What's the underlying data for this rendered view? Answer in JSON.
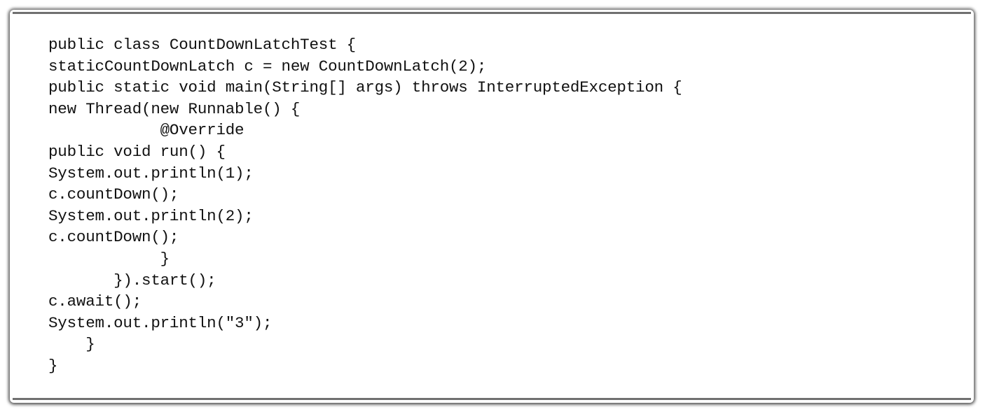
{
  "code_lines": [
    "public class CountDownLatchTest {",
    "staticCountDownLatch c = new CountDownLatch(2);",
    "public static void main(String[] args) throws InterruptedException {",
    "new Thread(new Runnable() {",
    "            @Override",
    "public void run() {",
    "System.out.println(1);",
    "c.countDown();",
    "System.out.println(2);",
    "c.countDown();",
    "            }",
    "       }).start();",
    "c.await();",
    "System.out.println(\"3\");",
    "    }",
    "}"
  ]
}
